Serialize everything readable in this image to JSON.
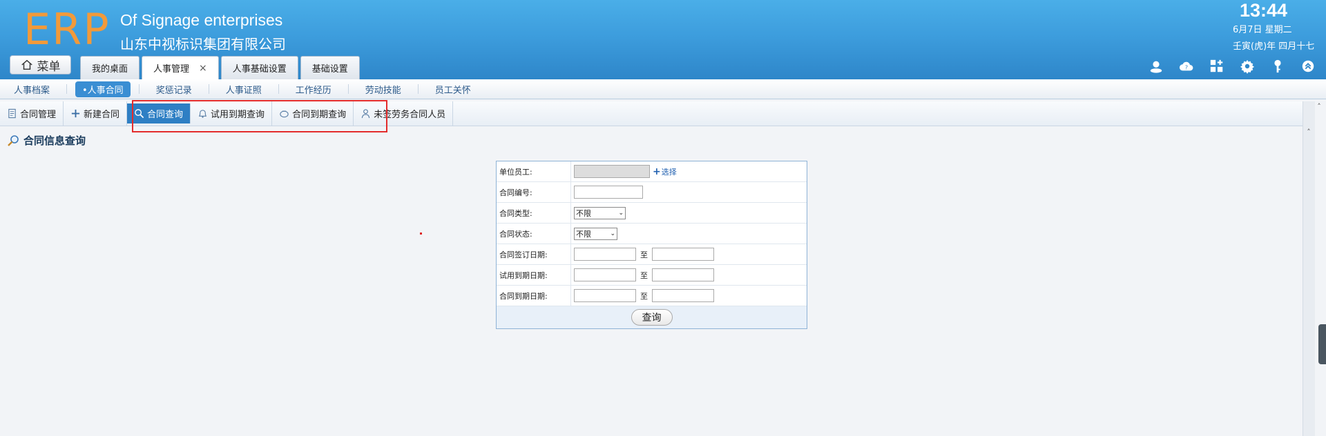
{
  "header": {
    "logo": "ERP",
    "company_en": "Of Signage enterprises",
    "company_cn": "山东中视标识集团有限公司",
    "time": "13:44",
    "date": "6月7日 星期二",
    "lunar": "壬寅(虎)年 四月十七"
  },
  "menu_button": {
    "label": "菜单"
  },
  "tabs": [
    {
      "label": "我的桌面"
    },
    {
      "label": "人事管理",
      "close": "×"
    },
    {
      "label": "人事基础设置"
    },
    {
      "label": "基础设置"
    }
  ],
  "header_icons": [
    "user-icon",
    "cloud-help-icon",
    "add-widget-icon",
    "settings-gear-icon",
    "key-icon",
    "collapse-up-icon"
  ],
  "subnav": [
    {
      "label": "人事档案"
    },
    {
      "label": "•人事合同"
    },
    {
      "label": "奖惩记录"
    },
    {
      "label": "人事证照"
    },
    {
      "label": "工作经历"
    },
    {
      "label": "劳动技能"
    },
    {
      "label": "员工关怀"
    }
  ],
  "toolbar": [
    {
      "label": "合同管理",
      "icon": "document-icon"
    },
    {
      "label": "新建合同",
      "icon": "plus-icon"
    },
    {
      "label": "合同查询",
      "icon": "search-icon"
    },
    {
      "label": "试用到期查询",
      "icon": "bell-icon"
    },
    {
      "label": "合同到期查询",
      "icon": "pot-icon"
    },
    {
      "label": "未签劳务合同人员",
      "icon": "person-icon"
    }
  ],
  "page_title": "合同信息查询",
  "form": {
    "employee_label": "单位员工:",
    "select_link": "选择",
    "contract_no_label": "合同编号:",
    "contract_type_label": "合同类型:",
    "contract_type_value": "不限",
    "contract_status_label": "合同状态:",
    "contract_status_value": "不限",
    "sign_date_label": "合同签订日期:",
    "trial_end_label": "试用到期日期:",
    "contract_end_label": "合同到期日期:",
    "to_label": "至",
    "query_button": "查询"
  },
  "colors": {
    "header_blue": "#3d9ddd",
    "logo_orange": "#f29a3a",
    "active_blue": "#2e7fc4",
    "highlight_red": "#e32b2b"
  }
}
